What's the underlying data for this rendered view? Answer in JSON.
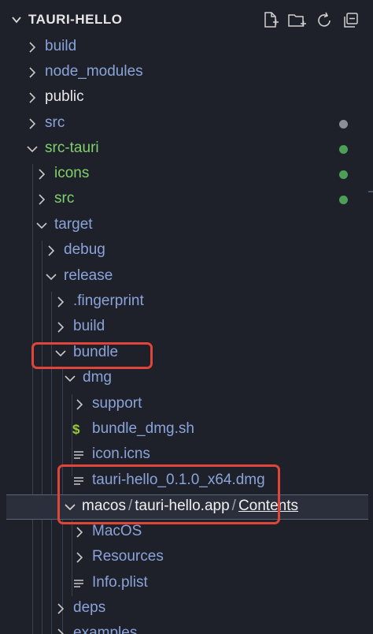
{
  "explorer": {
    "title": "TAURI-HELLO",
    "actions": [
      "new-file-icon",
      "new-folder-icon",
      "refresh-icon",
      "collapse-all-icon"
    ]
  },
  "colors": {
    "background": "#1e2129",
    "folder_text": "#8aa3d9",
    "modified_text": "#7fd16b",
    "highlight_box": "#e0453a",
    "dot_gray": "#8a8f99",
    "dot_green": "#4f9e57"
  },
  "tree": {
    "build": "build",
    "node_modules": "node_modules",
    "public": "public",
    "src": "src",
    "src_tauri": "src-tauri",
    "icons": "icons",
    "src_tauri_src": "src",
    "target": "target",
    "debug": "debug",
    "release": "release",
    "fingerprint": ".fingerprint",
    "release_build": "build",
    "bundle": "bundle",
    "dmg": "dmg",
    "support": "support",
    "bundle_dmg_sh": "bundle_dmg.sh",
    "icon_icns": "icon.icns",
    "tauri_hello_dmg": "tauri-hello_0.1.0_x64.dmg",
    "macos_path": {
      "part1": "macos",
      "sep": "/",
      "part2": "tauri-hello.app",
      "part3": "Contents"
    },
    "macos_dir": "MacOS",
    "resources": "Resources",
    "info_plist": "Info.plist",
    "deps": "deps",
    "examples": "examples"
  }
}
